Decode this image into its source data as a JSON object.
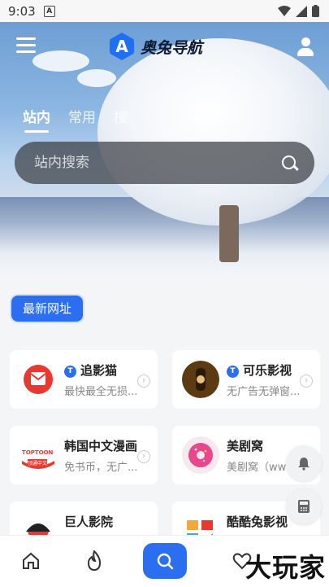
{
  "status_bar": {
    "time": "9:03",
    "notif_icon": "A"
  },
  "header": {
    "logo_mark": "A",
    "title": "奥兔导航"
  },
  "tabs": [
    {
      "label": "站内",
      "active": true
    },
    {
      "label": "常用",
      "active": false
    },
    {
      "label": "搜",
      "active": false
    }
  ],
  "search": {
    "placeholder": "站内搜索"
  },
  "section_badge": "最新网址",
  "cards": [
    {
      "name": "追影猫",
      "desc": "最快最全无损...",
      "tag": "T",
      "icon": "red-envelope-logo"
    },
    {
      "name": "可乐影视",
      "desc": "无广告无弹窗...",
      "tag": "T",
      "icon": "cola-bottle-logo"
    },
    {
      "name": "韩国中文漫画",
      "desc": "免书币，无广...",
      "tag": "",
      "icon": "toptoon-logo"
    },
    {
      "name": "美剧窝",
      "desc": "美剧窝（www...",
      "tag": "",
      "icon": "donut-logo"
    },
    {
      "name": "巨人影院",
      "desc": "",
      "tag": "",
      "icon": "giant-logo"
    },
    {
      "name": "酷酷兔影视",
      "desc": "",
      "tag": "",
      "icon": "cool-rabbit-logo"
    }
  ],
  "toptoon_text": {
    "top": "TOPTOON",
    "bottom": "顶通中文"
  },
  "bottom_nav": [
    "home-icon",
    "fire-icon",
    "search-icon",
    "heart-icon"
  ],
  "watermark": "大玩家",
  "colors": {
    "accent": "#2b6ff0",
    "badge_shadow": "#cfe0ff"
  }
}
